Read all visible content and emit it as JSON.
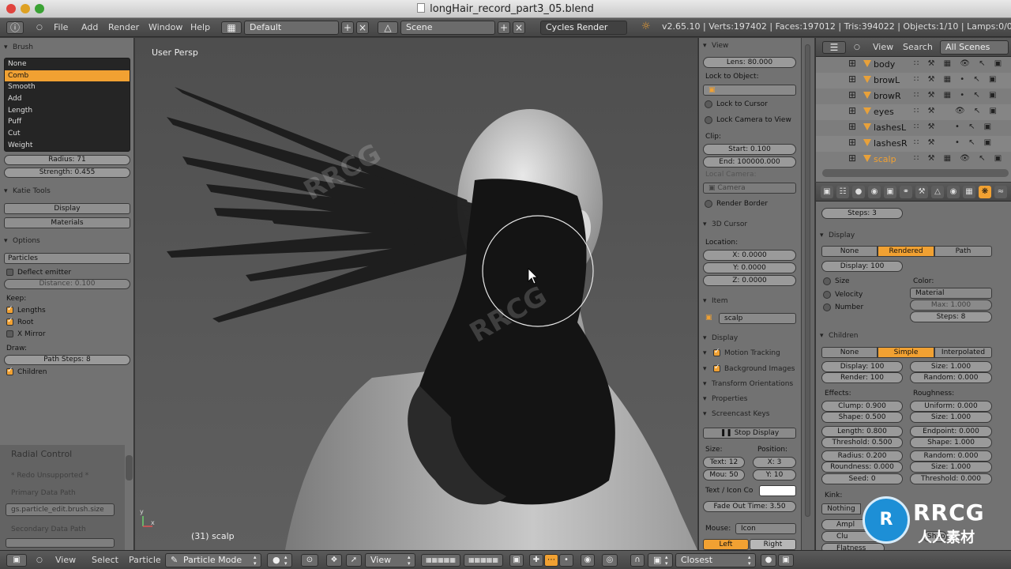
{
  "window": {
    "title": "longHair_record_part3_05.blend",
    "watermark": "RRCG"
  },
  "header": {
    "menus": [
      "File",
      "Add",
      "Render",
      "Window",
      "Help"
    ],
    "layout": "Default",
    "scene": "Scene",
    "engine": "Cycles Render",
    "stats": "v2.65.10 | Verts:197402 | Faces:197012 | Tris:394022 | Objects:1/10 | Lamps:0/0 | Me"
  },
  "tools": {
    "brush_header": "Brush",
    "brushes": [
      "None",
      "Comb",
      "Smooth",
      "Add",
      "Length",
      "Puff",
      "Cut",
      "Weight"
    ],
    "selected_brush": "Comb",
    "radius": "Radius: 71",
    "strength": "Strength: 0.455",
    "katie_header": "Katie Tools",
    "display_btn": "Display",
    "materials_btn": "Materials",
    "options_header": "Options",
    "mode": "Particles",
    "deflect": "Deflect emitter",
    "distance": "Distance: 0.100",
    "keep_label": "Keep:",
    "lengths": "Lengths",
    "root": "Root",
    "xmirror": "X Mirror",
    "draw_label": "Draw:",
    "path_steps": "Path Steps: 8",
    "children": "Children",
    "radial_header": "Radial Control",
    "redo": "* Redo Unsupported *",
    "primary": "Primary Data Path",
    "primary_val": "gs.particle_edit.brush.size",
    "secondary": "Secondary Data Path"
  },
  "viewport": {
    "label": "User Persp",
    "object": "(31) scalp"
  },
  "npanel": {
    "view_header": "View",
    "lens": "Lens: 80.000",
    "lock_object": "Lock to Object:",
    "lock_cursor": "Lock to Cursor",
    "lock_camera": "Lock Camera to View",
    "clip": "Clip:",
    "clip_start": "Start: 0.100",
    "clip_end": "End: 100000.000",
    "local_camera": "Local Camera:",
    "camera": "Camera",
    "render_border": "Render Border",
    "cursor_header": "3D Cursor",
    "location": "Location:",
    "x": "X: 0.0000",
    "y": "Y: 0.0000",
    "z": "Z: 0.0000",
    "item_header": "Item",
    "item_name": "scalp",
    "display_header": "Display",
    "motion_tracking": "Motion Tracking",
    "background_images": "Background Images",
    "transform_orient": "Transform Orientations",
    "properties": "Properties",
    "screencast_header": "Screencast Keys",
    "stop_display": "Stop Display",
    "size_label": "Size:",
    "position_label": "Position:",
    "text_size": "Text: 12",
    "pos_x": "X: 3",
    "mou_size": "Mou: 50",
    "pos_y": "Y: 10",
    "text_icon": "Text / Icon Co",
    "fade_out": "Fade Out Time: 3.50",
    "mouse_label": "Mouse:",
    "mouse_val": "Icon",
    "left": "Left",
    "right": "Right"
  },
  "outliner": {
    "menus": [
      "View",
      "Search"
    ],
    "filter": "All Scenes",
    "rows": [
      "body",
      "browL",
      "browR",
      "eyes",
      "lashesL",
      "lashesR",
      "scalp"
    ]
  },
  "props": {
    "steps_top": "Steps: 3",
    "display_header": "Display",
    "disp_none": "None",
    "disp_rendered": "Rendered",
    "disp_path": "Path",
    "display_pct": "Display: 100",
    "size": "Size",
    "velocity": "Velocity",
    "number": "Number",
    "color_label": "Color:",
    "color_val": "Material",
    "max": "Max: 1.000",
    "steps": "Steps: 8",
    "children_header": "Children",
    "ch_none": "None",
    "ch_simple": "Simple",
    "ch_interp": "Interpolated",
    "ch_display": "Display: 100",
    "ch_size": "Size: 1.000",
    "ch_render": "Render: 100",
    "ch_random": "Random: 0.000",
    "effects": "Effects:",
    "roughness": "Roughness:",
    "clump": "Clump: 0.900",
    "uniform": "Uniform: 0.000",
    "shape": "Shape: 0.500",
    "r_size": "Size: 1.000",
    "length": "Length: 0.800",
    "endpoint": "Endpoint: 0.000",
    "threshold": "Threshold: 0.500",
    "r_shape": "Shape: 1.000",
    "radius": "Radius: 0.200",
    "r_random": "Random: 0.000",
    "roundness": "Roundness: 0.000",
    "r_size2": "Size: 1.000",
    "seed": "Seed: 0",
    "r_threshold": "Threshold: 0.000",
    "kink": "Kink:",
    "kink_none": "Nothing",
    "ampl": "Ampl",
    "clu": "Clu",
    "flatness": "Flatness",
    "shap": "Shap"
  },
  "bottombar": {
    "menus": [
      "View",
      "Select",
      "Particle"
    ],
    "mode": "Particle Mode",
    "view": "View",
    "snap": "Closest"
  },
  "logo": {
    "brand": "RRCG",
    "cn": "人人素材"
  },
  "colors": {
    "accent": "#f1a132",
    "panel": "#727272",
    "viewport": "#555555"
  }
}
